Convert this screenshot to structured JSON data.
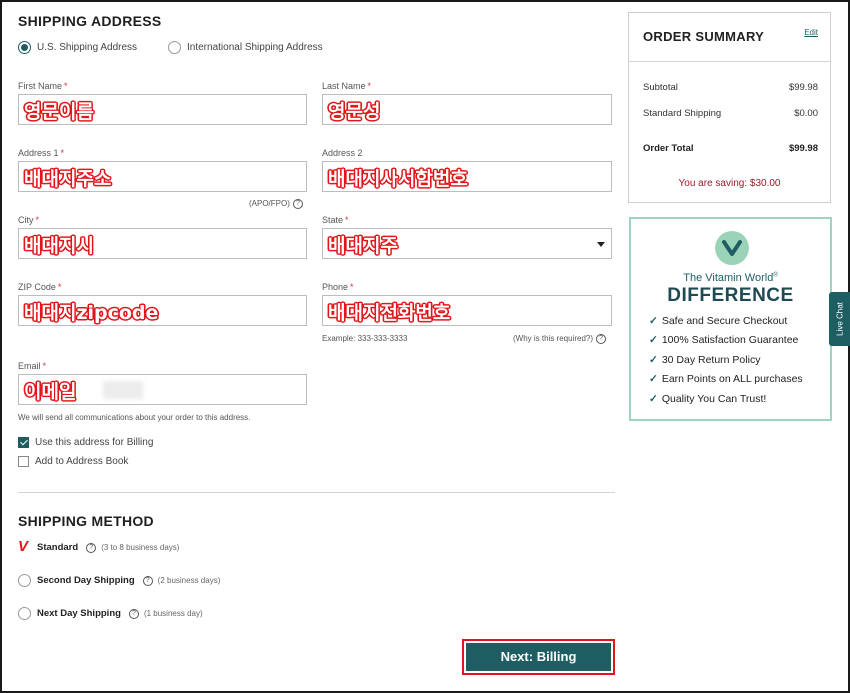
{
  "shipping": {
    "title": "SHIPPING ADDRESS",
    "options": {
      "us": "U.S. Shipping Address",
      "intl": "International Shipping Address"
    },
    "fields": {
      "first_name": {
        "label": "First Name",
        "value": "영문이름"
      },
      "last_name": {
        "label": "Last Name",
        "value": "영문성"
      },
      "address1": {
        "label": "Address 1",
        "value": "배대지주소"
      },
      "address2": {
        "label": "Address 2",
        "value": "배대지사서함번호"
      },
      "city": {
        "label": "City",
        "value": "배대지시"
      },
      "state": {
        "label": "State",
        "value": "배대지주"
      },
      "zip": {
        "label": "ZIP Code",
        "value": "배대지zipcode"
      },
      "phone": {
        "label": "Phone",
        "value": "배대지전화번호"
      },
      "email": {
        "label": "Email",
        "value": "이메일"
      }
    },
    "required_mark": "*",
    "apo_note": "(APO/FPO)",
    "phone_example": "Example: 333-333-3333",
    "phone_why": "(Why is this required?)",
    "help_glyph": "?",
    "email_note": "We will send all communications about your order to this address.",
    "use_billing": "Use this address for Billing",
    "add_book": "Add to Address Book"
  },
  "method": {
    "title": "SHIPPING METHOD",
    "options": [
      {
        "name": "Standard",
        "days": "(3 to 8 business days)"
      },
      {
        "name": "Second Day Shipping",
        "days": "(2 business days)"
      },
      {
        "name": "Next Day Shipping",
        "days": "(1 business day)"
      }
    ],
    "selected_mark": "V"
  },
  "next_button": "Next: Billing",
  "summary": {
    "title": "ORDER SUMMARY",
    "edit": "Edit",
    "subtotal_label": "Subtotal",
    "subtotal": "$99.98",
    "shipping_label": "Standard Shipping",
    "shipping": "$0.00",
    "total_label": "Order Total",
    "total": "$99.98",
    "saving": "You are saving: $30.00"
  },
  "difference": {
    "subtitle": "The Vitamin World",
    "reg": "®",
    "heading": "DIFFERENCE",
    "check": "✓",
    "items": [
      "Safe and Secure Checkout",
      "100% Satisfaction Guarantee",
      "30 Day Return Policy",
      "Earn Points on ALL purchases",
      "Quality You Can Trust!"
    ]
  },
  "live_chat": "Live Chat",
  "colors": {
    "brand": "#1e5e62",
    "annotation": "#e3151a",
    "saving": "#9b1b25",
    "accent_border": "#9fd4be"
  }
}
